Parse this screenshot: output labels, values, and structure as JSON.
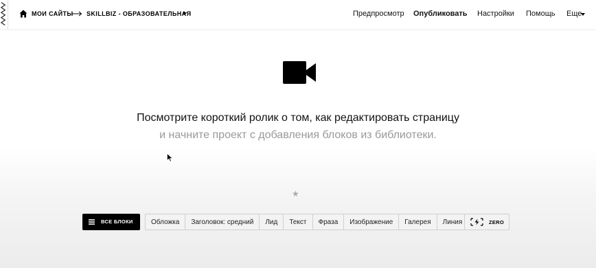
{
  "header": {
    "breadcrumb_root": "МОИ САЙТЫ",
    "breadcrumb_project": "SKILLBIZ - ОБРАЗОВАТЕЛЬНАЯ",
    "nav": {
      "preview": "Предпросмотр",
      "publish": "Опубликовать",
      "settings": "Настройки",
      "help": "Помощь",
      "more": "Еще"
    }
  },
  "main": {
    "icon": "video-camera-icon",
    "headline": "Посмотрите короткий ролик о том, как редактировать страницу",
    "subline": "и начните проект с добавления блоков из библиотеки."
  },
  "toolbar": {
    "all_blocks_label": "ВСЕ БЛОКИ",
    "tags": [
      "Обложка",
      "Заголовок: средний",
      "Лид",
      "Текст",
      "Фраза",
      "Изображение",
      "Галерея",
      "Линия"
    ],
    "zero_label": "ZERO"
  },
  "colors": {
    "accent": "#000000",
    "muted_text": "#999999",
    "toolbar_bg": "#f3f3f3"
  }
}
